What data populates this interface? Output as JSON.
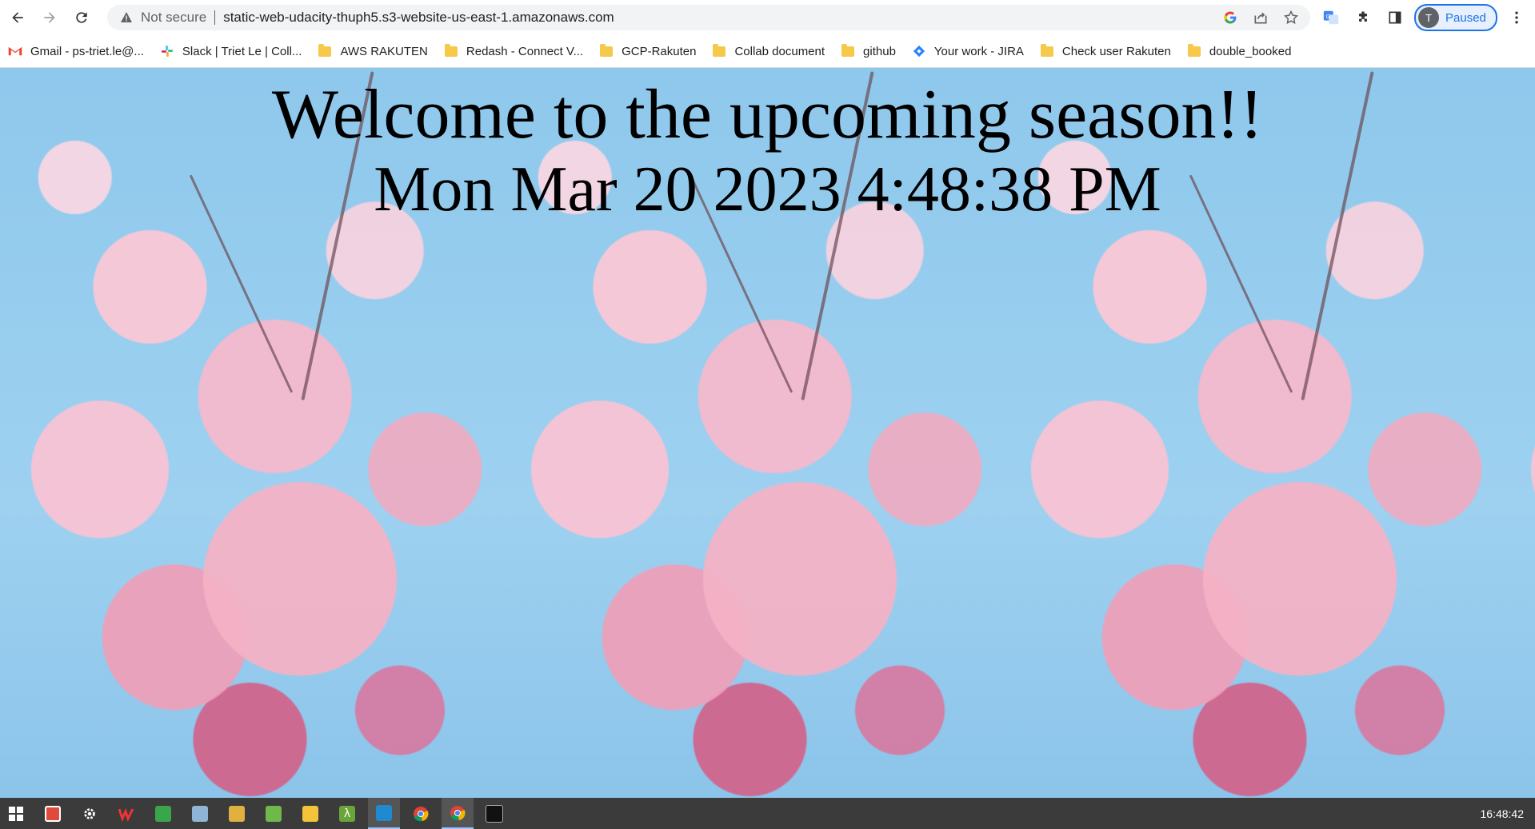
{
  "browser": {
    "security_label": "Not secure",
    "url": "static-web-udacity-thuph5.s3-website-us-east-1.amazonaws.com",
    "profile_initial": "T",
    "profile_status": "Paused"
  },
  "bookmarks": [
    {
      "label": "Gmail - ps-triet.le@...",
      "icon": "gmail-icon"
    },
    {
      "label": "Slack | Triet Le | Coll...",
      "icon": "slack-icon"
    },
    {
      "label": "AWS RAKUTEN",
      "icon": "folder-icon"
    },
    {
      "label": "Redash - Connect V...",
      "icon": "folder-icon"
    },
    {
      "label": "GCP-Rakuten",
      "icon": "folder-icon"
    },
    {
      "label": "Collab document",
      "icon": "folder-icon"
    },
    {
      "label": "github",
      "icon": "folder-icon"
    },
    {
      "label": "Your work - JIRA",
      "icon": "jira-icon"
    },
    {
      "label": "Check user Rakuten",
      "icon": "folder-icon"
    },
    {
      "label": "double_booked",
      "icon": "folder-icon"
    }
  ],
  "page": {
    "title": "Welcome to the upcoming season!!",
    "datetime": "Mon Mar 20 2023 4:48:38 PM"
  },
  "taskbar": {
    "clock": "16:48:42",
    "items": [
      "windows-start-icon",
      "red-app-icon",
      "gear-icon",
      "wps-icon",
      "green-app-icon",
      "remote-icon",
      "explorer-drive-icon",
      "notepad-icon",
      "file-explorer-icon",
      "lambda-icon",
      "vscode-icon",
      "chrome-icon",
      "chrome-icon",
      "terminal-icon"
    ]
  },
  "colors": {
    "sky": "#9fd0ee",
    "blossom": "#f4b6c8",
    "accent": "#1a73e8"
  }
}
